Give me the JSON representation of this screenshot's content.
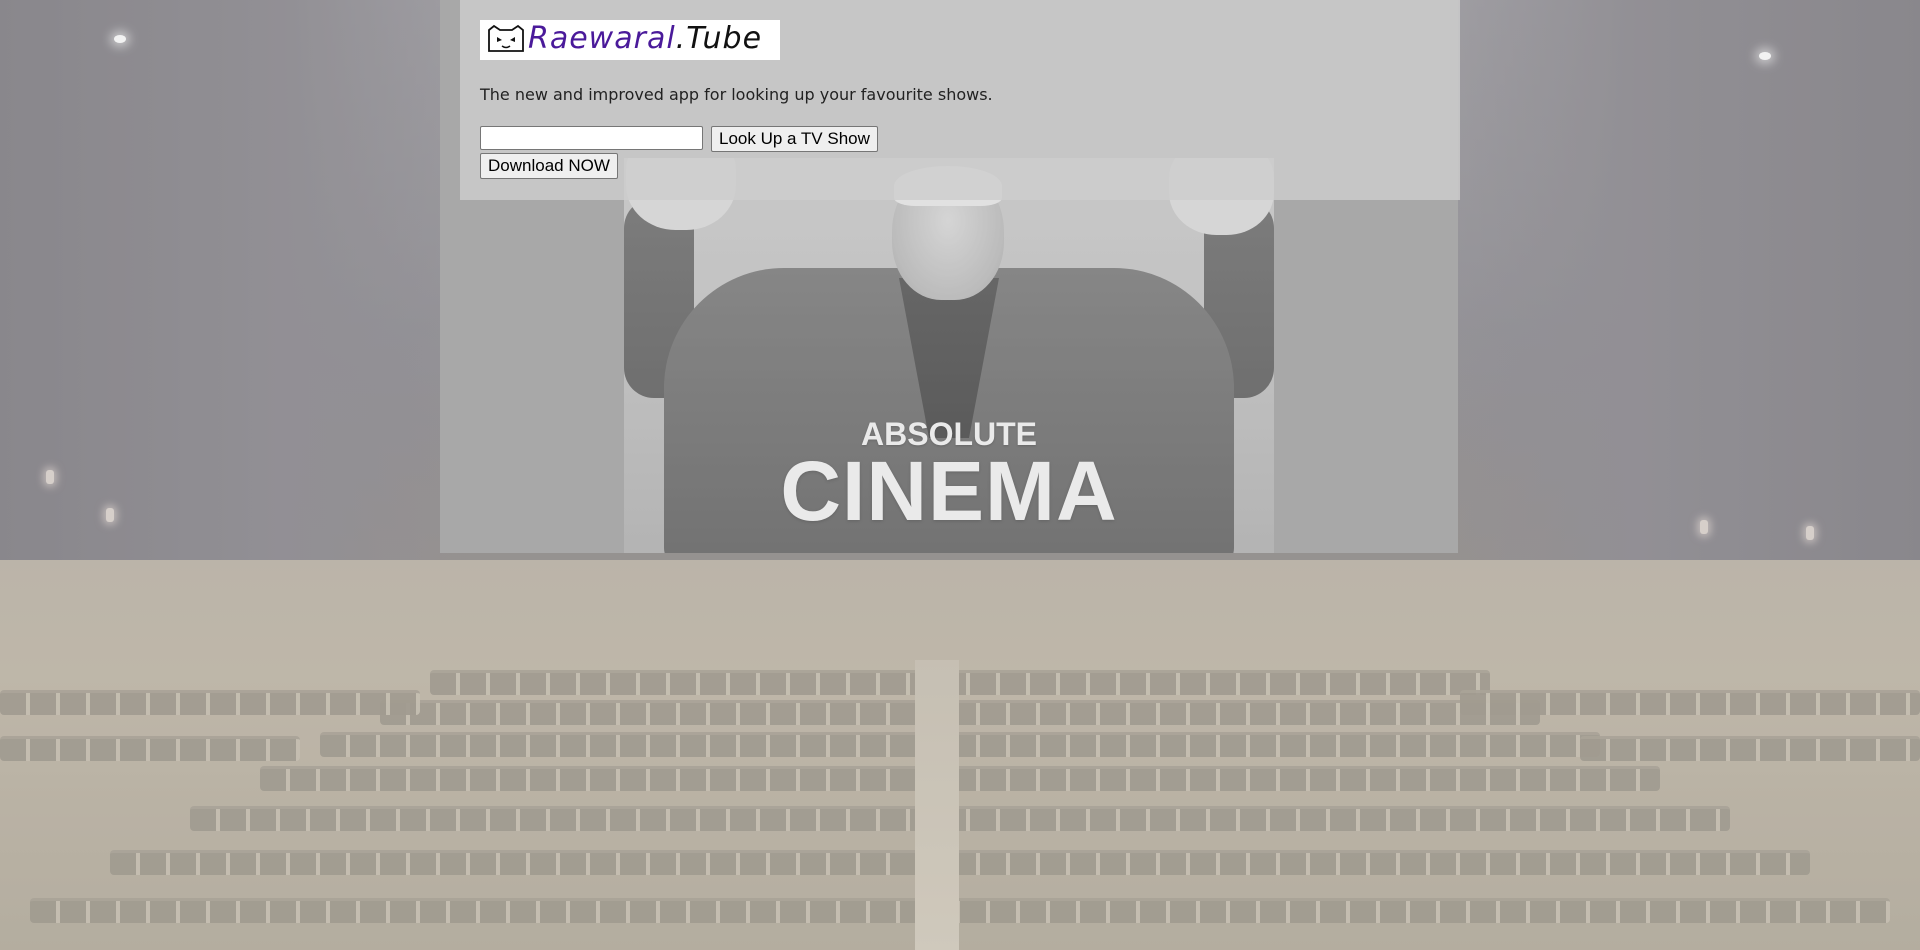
{
  "header": {
    "logo_main": "Raewaral",
    "logo_suffix": ".Tube",
    "tagline": "The new and improved app for looking up your favourite shows."
  },
  "search": {
    "value": "",
    "placeholder": "",
    "lookup_label": "Look Up a TV Show"
  },
  "download": {
    "label": "Download NOW"
  },
  "poster": {
    "line1": "ABSOLUTE",
    "line2": "CINEMA"
  },
  "colors": {
    "logo_text": "#4a1a9a",
    "panel_bg": "#cdcdcd",
    "screen_bg": "#999999"
  }
}
